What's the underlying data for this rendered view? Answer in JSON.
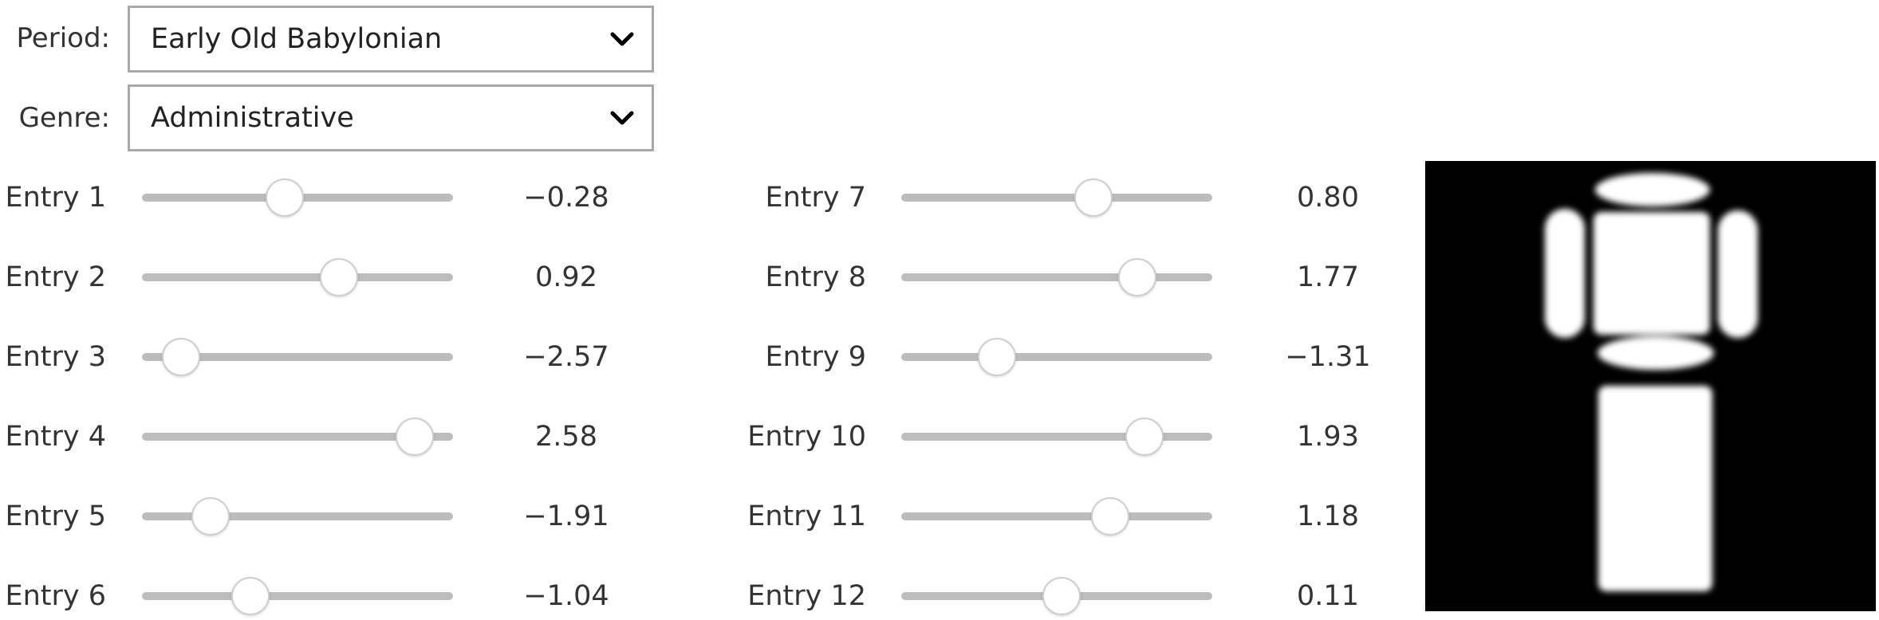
{
  "period": {
    "label": "Period:",
    "value": "Early Old Babylonian"
  },
  "genre": {
    "label": "Genre:",
    "value": "Administrative"
  },
  "sliders": [
    {
      "label": "Entry 1",
      "value": "−0.28",
      "level": -0.28
    },
    {
      "label": "Entry 2",
      "value": "0.92",
      "level": 0.92
    },
    {
      "label": "Entry 3",
      "value": "−2.57",
      "level": -2.57
    },
    {
      "label": "Entry 4",
      "value": "2.58",
      "level": 2.58
    },
    {
      "label": "Entry 5",
      "value": "−1.91",
      "level": -1.91
    },
    {
      "label": "Entry 6",
      "value": "−1.04",
      "level": -1.04
    },
    {
      "label": "Entry 7",
      "value": "0.80",
      "level": 0.8
    },
    {
      "label": "Entry 8",
      "value": "1.77",
      "level": 1.77
    },
    {
      "label": "Entry 9",
      "value": "−1.31",
      "level": -1.31
    },
    {
      "label": "Entry 10",
      "value": "1.93",
      "level": 1.93
    },
    {
      "label": "Entry 11",
      "value": "1.18",
      "level": 1.18
    },
    {
      "label": "Entry 12",
      "value": "0.11",
      "level": 0.11
    }
  ],
  "slider_range": [
    -3,
    3
  ],
  "colors": {
    "track": "#bdbdbd",
    "thumb": "#ffffff",
    "preview_background": "#000000",
    "preview_glyph": "#ffffff"
  },
  "icons": {
    "dropdown": "chevron-down-icon"
  }
}
